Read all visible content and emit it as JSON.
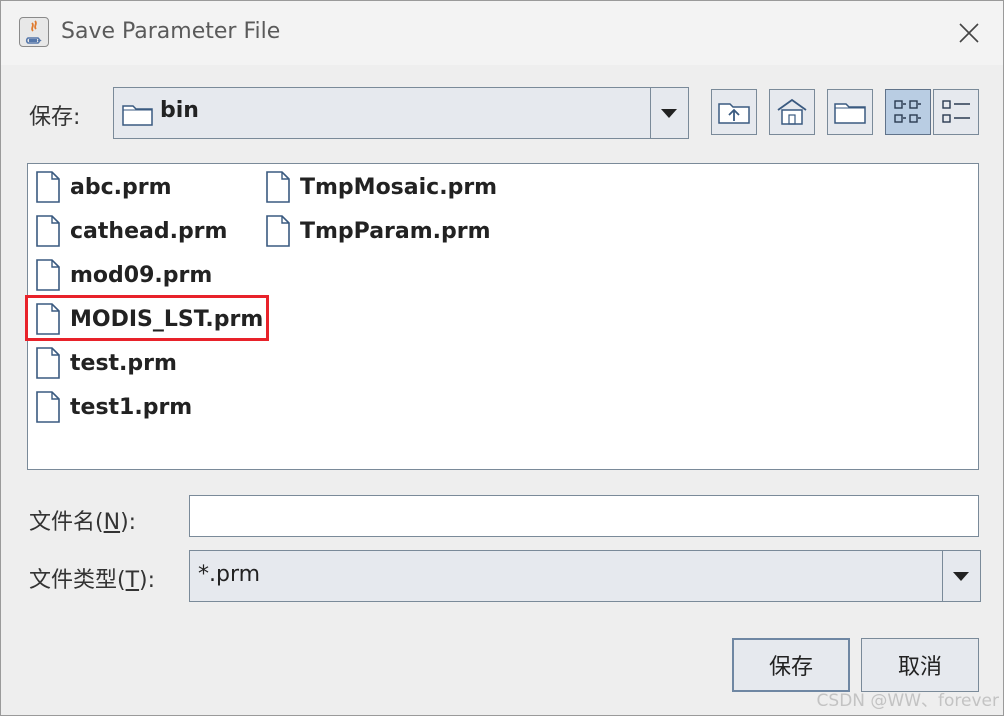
{
  "window": {
    "title": "Save Parameter File",
    "icon": "java-coffee-cup-icon"
  },
  "save_in": {
    "label": "保存:",
    "value": "bin"
  },
  "toolbar": {
    "buttons": [
      {
        "icon": "up-one-level-icon"
      },
      {
        "icon": "home-icon"
      },
      {
        "icon": "new-folder-icon"
      },
      {
        "icon": "list-view-icon",
        "active": true
      },
      {
        "icon": "details-view-icon",
        "active": false
      }
    ]
  },
  "files": [
    {
      "name": "abc.prm"
    },
    {
      "name": "cathead.prm"
    },
    {
      "name": "mod09.prm"
    },
    {
      "name": "MODIS_LST.prm",
      "highlighted": true
    },
    {
      "name": "test.prm"
    },
    {
      "name": "test1.prm"
    },
    {
      "name": "TmpMosaic.prm"
    },
    {
      "name": "TmpParam.prm"
    }
  ],
  "filename": {
    "label_prefix": "文件名(",
    "label_mnemonic": "N",
    "label_suffix": "):",
    "value": ""
  },
  "filetype": {
    "label_prefix": "文件类型(",
    "label_mnemonic": "T",
    "label_suffix": "):",
    "value": "*.prm"
  },
  "buttons": {
    "save_label": "保存",
    "cancel_label": "取消"
  },
  "watermark": "CSDN @WW、forever",
  "colors": {
    "highlight_border": "#e8222a",
    "button_bg": "#e6e9ee",
    "active_toggle_bg": "#b9cde3"
  }
}
